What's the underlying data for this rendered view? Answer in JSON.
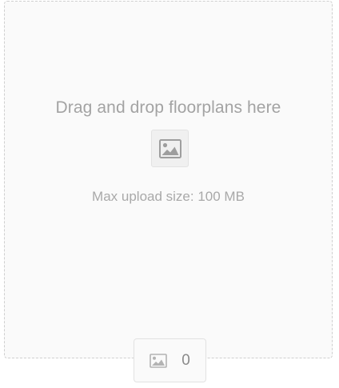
{
  "dropzone": {
    "title": "Drag and drop floorplans here",
    "max_upload_label": "Max upload size: 100 MB",
    "browse_icon": "image-icon"
  },
  "counter": {
    "icon": "image-icon",
    "count": "0"
  },
  "colors": {
    "dropzone_bg": "#fafafa",
    "dropzone_border": "#cfcfcf",
    "text_muted": "#a3a3a3",
    "icon_gray": "#a8a8a8"
  }
}
